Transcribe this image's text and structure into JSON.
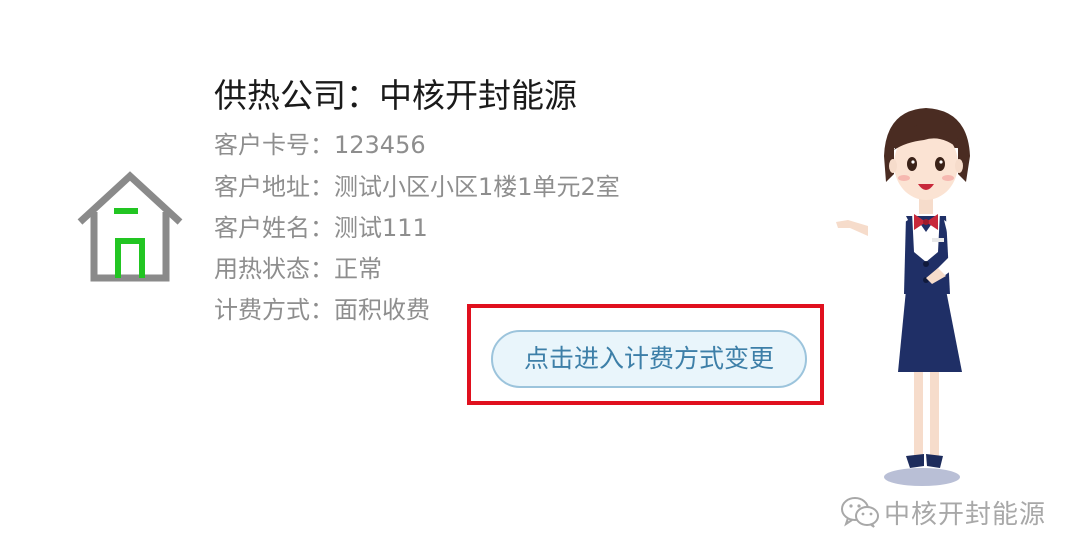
{
  "company": {
    "label": "供热公司：",
    "value": "中核开封能源"
  },
  "info_rows": [
    {
      "label": "客户卡号：",
      "value": "123456"
    },
    {
      "label": "客户地址：",
      "value": "测试小区小区1楼1单元2室"
    },
    {
      "label": "客户姓名：",
      "value": "测试111"
    },
    {
      "label": "用热状态：",
      "value": "正常"
    },
    {
      "label": "计费方式：",
      "value": "面积收费"
    }
  ],
  "actions": {
    "change_billing_label": "点击进入计费方式变更"
  },
  "watermark": {
    "text": "中核开封能源",
    "icon": "wechat-icon"
  },
  "icons": {
    "house": "house-icon",
    "attendant": "service-attendant-illustration"
  },
  "colors": {
    "company_text": "#1a1a1a",
    "info_text": "#8e8e8e",
    "house_outline": "#8a8a8a",
    "house_accent": "#22c522",
    "button_bg": "#e9f5fb",
    "button_border": "#9cc4dc",
    "button_text": "#3d7fa8",
    "highlight_frame": "#e0101e",
    "watermark_text": "#a8a8a8"
  }
}
